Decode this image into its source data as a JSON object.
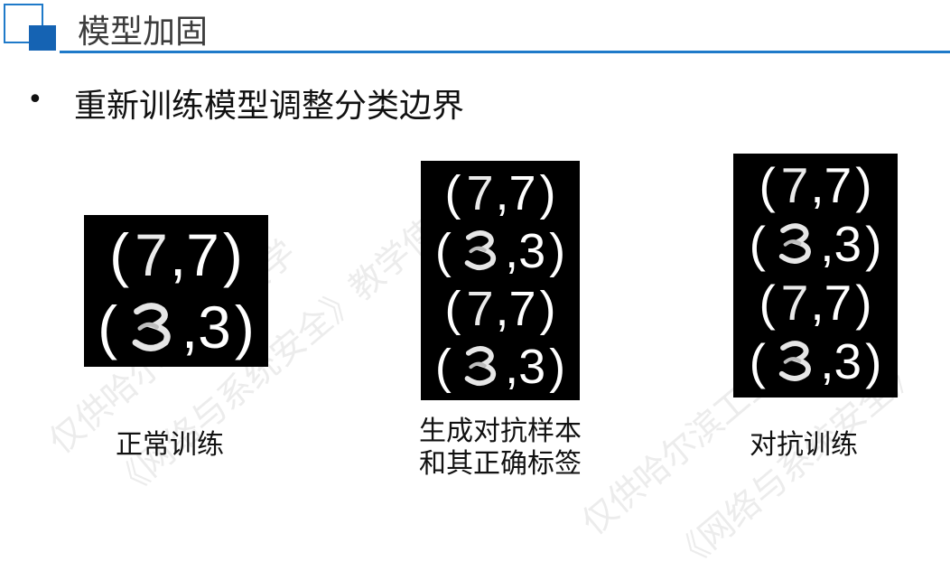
{
  "slide": {
    "title": "模型加固",
    "bullet": "重新训练模型调整分类边界",
    "bullet_marker": "•"
  },
  "panels": [
    {
      "caption_lines": [
        "正常训练"
      ],
      "rows": [
        {
          "open": "(",
          "digit_img": "7",
          "label": ",7",
          "close": ")"
        },
        {
          "open": "(",
          "digit_img": "3",
          "label": ",3",
          "close": ")"
        }
      ]
    },
    {
      "caption_lines": [
        "生成对抗样本",
        "和其正确标签"
      ],
      "rows": [
        {
          "open": "(",
          "digit_img": "7",
          "label": ",7",
          "close": ")"
        },
        {
          "open": "(",
          "digit_img": "3",
          "label": ",3",
          "close": ")"
        },
        {
          "open": "(",
          "digit_img": "7",
          "label": ",7",
          "close": ")"
        },
        {
          "open": "(",
          "digit_img": "3",
          "label": ",3",
          "close": ")"
        }
      ]
    },
    {
      "caption_lines": [
        "对抗训练"
      ],
      "rows": [
        {
          "open": "(",
          "digit_img": "7",
          "label": ",7",
          "close": ")"
        },
        {
          "open": "(",
          "digit_img": "3",
          "label": ",3",
          "close": ")"
        },
        {
          "open": "(",
          "digit_img": "7",
          "label": ",7",
          "close": ")"
        },
        {
          "open": "(",
          "digit_img": "3",
          "label": ",3",
          "close": ")"
        }
      ]
    }
  ],
  "colors": {
    "accent": "#1f7ac9",
    "accent_dark": "#1563b3",
    "panel_bg": "#000000"
  }
}
